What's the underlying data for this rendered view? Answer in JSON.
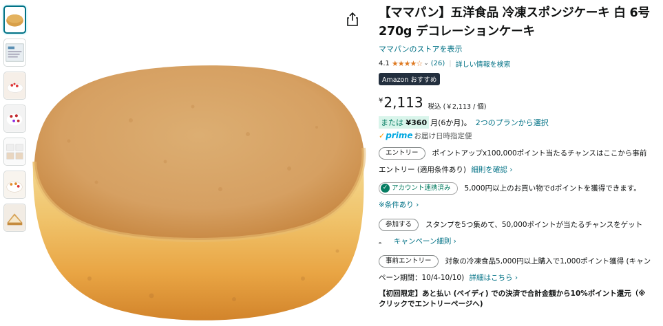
{
  "product": {
    "title": "【ママパン】五洋食品 冷凍スポンジケーキ 白 6号 270g デコレーションケーキ",
    "store_link": "ママパンのストアを表示",
    "rating_value": "4.1",
    "rating_stars": 4.1,
    "rating_stars_glyphs": "★★★★☆",
    "rating_count": "(26)",
    "detail_link": "詳しい情報を検索",
    "badge": "Amazon おすすめ",
    "price_symbol": "¥",
    "price": "2,113",
    "tax_note": "税込 (￥2,113 / 個)",
    "installment_prefix": "または",
    "installment_amount": "¥360",
    "installment_suffix": "月(6か月)。",
    "installment_plans": "2つのプランから選択",
    "prime_check": "✓",
    "prime_label": "prime",
    "prime_delivery": "お届け日時指定便"
  },
  "promos": [
    {
      "pill": "エントリー",
      "text": "ポイントアップx100,000ポイント当たるチャンスはここから事前",
      "text2": "エントリー (適用条件あり)",
      "link": "細則を確認 ›"
    },
    {
      "pill": "アカウント連携済み",
      "text": "5,000円以上のお買い物でdポイントを獲得できます。",
      "link": "※条件あり ›"
    },
    {
      "pill": "参加する",
      "text": "スタンプを5つ集めて、50,000ポイントが当たるチャンスをゲット",
      "text2": "。",
      "link": "キャンペーン細則 ›"
    },
    {
      "pill": "事前エントリー",
      "text": "対象の冷凍食品5,000円以上購入で1,000ポイント獲得 (キャン",
      "text2": "ペーン期間：10/4-10/10)",
      "link": "詳細はこちら ›"
    }
  ],
  "bold_promo": {
    "line1": "【初回限定】あと払い (ペイディ) での決済で合計金額から10%ポイント還元（※",
    "line2": "クリックでエントリーページへ)"
  },
  "icons": {
    "share": "share-icon",
    "check": "check-circle-icon",
    "star": "star-icon"
  },
  "colors": {
    "link": "#007185",
    "star": "#de7921",
    "badge_bg": "#232f3e",
    "installment_bg": "#d9f5eb",
    "prime": "#00a8e1"
  }
}
